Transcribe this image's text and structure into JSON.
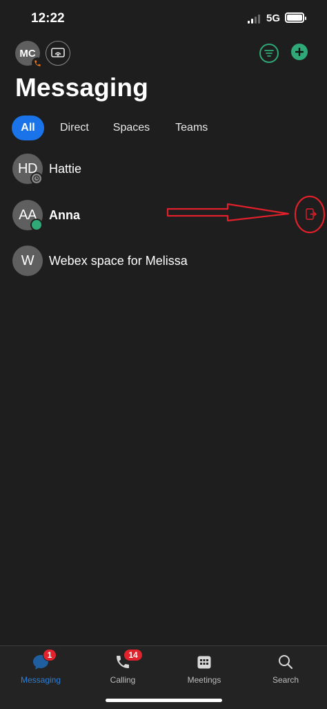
{
  "status_bar": {
    "time": "12:22",
    "network": "5G"
  },
  "header": {
    "user_initials": "MC",
    "title": "Messaging"
  },
  "tabs": [
    {
      "label": "All",
      "active": true
    },
    {
      "label": "Direct",
      "active": false
    },
    {
      "label": "Spaces",
      "active": false
    },
    {
      "label": "Teams",
      "active": false
    }
  ],
  "conversations": [
    {
      "initials": "HD",
      "name": "Hattie",
      "presence": "away",
      "bold": false
    },
    {
      "initials": "AA",
      "name": "Anna",
      "presence": "active",
      "bold": true
    },
    {
      "initials": "W",
      "name": "Webex space for Melissa",
      "presence": "none",
      "bold": false
    }
  ],
  "bottom_nav": [
    {
      "label": "Messaging",
      "icon": "chat-bubble-icon",
      "badge": "1",
      "active": true
    },
    {
      "label": "Calling",
      "icon": "phone-icon",
      "badge": "14",
      "active": false
    },
    {
      "label": "Meetings",
      "icon": "calendar-icon",
      "badge": "",
      "active": false
    },
    {
      "label": "Search",
      "icon": "search-icon",
      "badge": "",
      "active": false
    }
  ],
  "colors": {
    "background": "#1e1e1e",
    "accent_blue": "#1a73e8",
    "accent_green": "#2fa977",
    "badge_red": "#e0232c",
    "annotation_red": "#e0202a"
  }
}
